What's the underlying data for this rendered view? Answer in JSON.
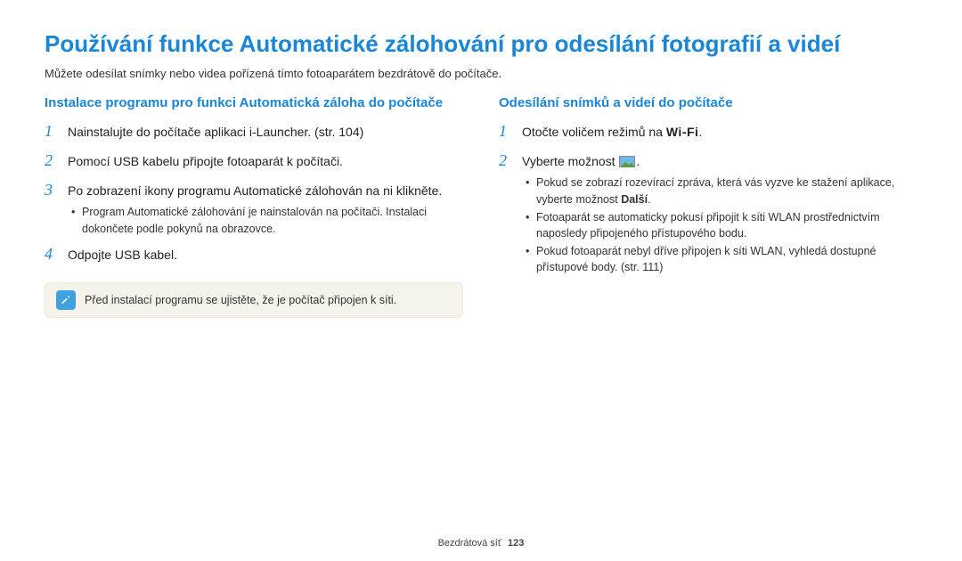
{
  "title": "Používání funkce Automatické zálohování pro odesílání fotografií a videí",
  "intro": "Můžete odesílat snímky nebo videa pořízená tímto fotoaparátem bezdrátově do počítače.",
  "left": {
    "heading": "Instalace programu pro funkci Automatická záloha do počítače",
    "steps": {
      "s1": "Nainstalujte do počítače aplikaci i-Launcher. (str. 104)",
      "s2": "Pomocí USB kabelu připojte fotoaparát k počítači.",
      "s3": "Po zobrazení ikony programu Automatické zálohován na ni klikněte.",
      "s3sub": "Program Automatické zálohování je nainstalován na počítači. Instalaci dokončete podle pokynů na obrazovce.",
      "s4": "Odpojte USB kabel."
    },
    "note": "Před instalací programu se ujistěte, že je počítač připojen k síti."
  },
  "right": {
    "heading": "Odesílání snímků a videí do počítače",
    "steps": {
      "s1_pre": "Otočte voličem režimů na ",
      "s1_wifi": "Wi-Fi",
      "s1_post": ".",
      "s2_pre": "Vyberte možnost ",
      "s2_post": ".",
      "b1_pre": "Pokud se zobrazí rozevírací zpráva, která vás vyzve ke stažení aplikace, vyberte možnost ",
      "b1_strong": "Další",
      "b1_post": ".",
      "b2": "Fotoaparát se automaticky pokusí připojit k síti WLAN prostřednictvím naposledy připojeného přístupového bodu.",
      "b3": "Pokud fotoaparát nebyl dříve připojen k síti WLAN, vyhledá dostupné přístupové body. (str. 111)"
    }
  },
  "footer": {
    "section": "Bezdrátová síť",
    "page": "123"
  }
}
